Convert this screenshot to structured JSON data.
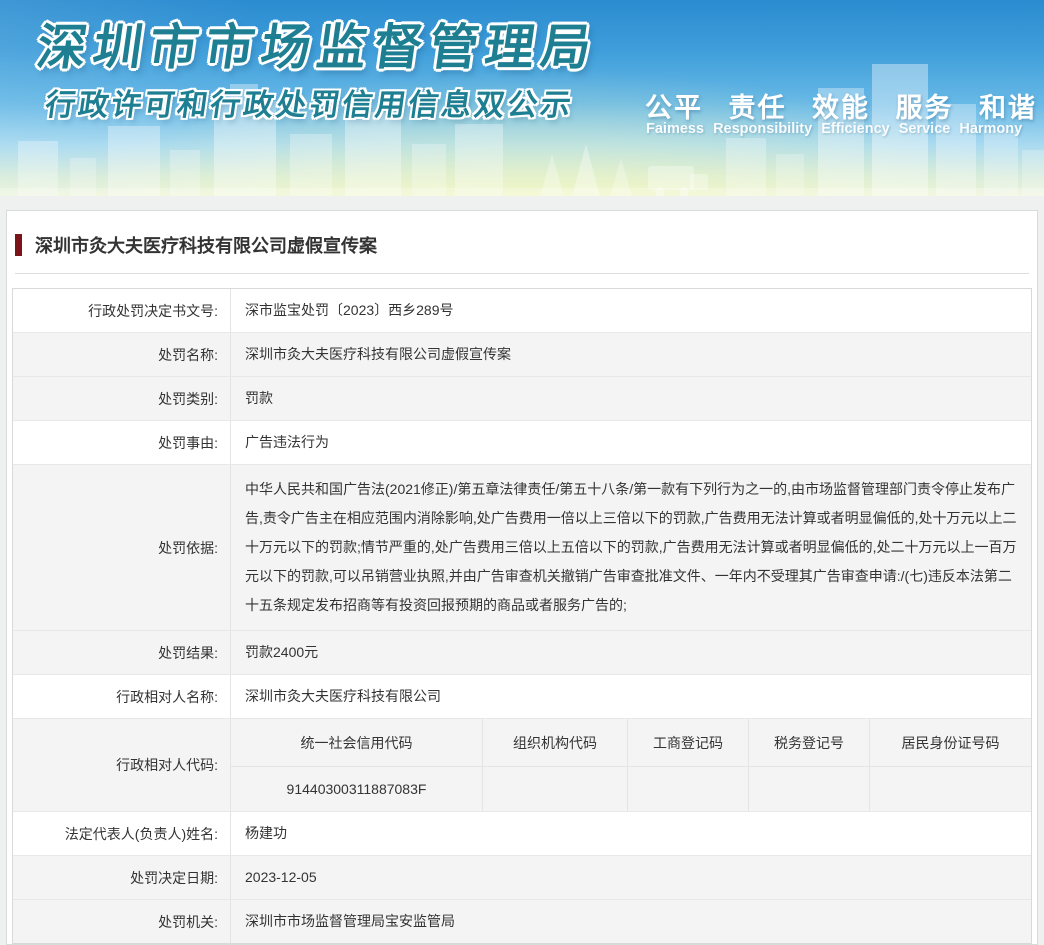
{
  "banner": {
    "agency_title": "深圳市市场监督管理局",
    "banner_subtitle": "行政许可和行政处罚信用信息双公示",
    "slogan_cn": "公平 责任 效能 服务 和谐",
    "slogan_en": "Faimess Responsibility Efficiency Service Harmony",
    "colors": {
      "banner_top_blue": "#2a8bd0",
      "banner_bottom_green": "#ebf4da",
      "title_teal": "#1e7f92"
    }
  },
  "page": {
    "case_title": "深圳市灸大夫医疗科技有限公司虚假宣传案",
    "title_marker_color": "#7a1418"
  },
  "table": {
    "rows": [
      {
        "label": "行政处罚决定书文号:",
        "value": "深市监宝处罚〔2023〕西乡289号"
      },
      {
        "label": "处罚名称:",
        "value": "深圳市灸大夫医疗科技有限公司虚假宣传案"
      },
      {
        "label": "处罚类别:",
        "value": "罚款"
      },
      {
        "label": "处罚事由:",
        "value": "广告违法行为"
      },
      {
        "label": "处罚依据:",
        "value": "中华人民共和国广告法(2021修正)/第五章法律责任/第五十八条/第一款有下列行为之一的,由市场监督管理部门责令停止发布广告,责令广告主在相应范围内消除影响,处广告费用一倍以上三倍以下的罚款,广告费用无法计算或者明显偏低的,处十万元以上二十万元以下的罚款;情节严重的,处广告费用三倍以上五倍以下的罚款,广告费用无法计算或者明显偏低的,处二十万元以上一百万元以下的罚款,可以吊销营业执照,并由广告审查机关撤销广告审查批准文件、一年内不受理其广告审查申请:/(七)违反本法第二十五条规定发布招商等有投资回报预期的商品或者服务广告的;"
      },
      {
        "label": "处罚结果:",
        "value": "罚款2400元"
      },
      {
        "label": "行政相对人名称:",
        "value": "深圳市灸大夫医疗科技有限公司"
      },
      {
        "label": "法定代表人(负责人)姓名:",
        "value": "杨建功"
      },
      {
        "label": "处罚决定日期:",
        "value": "2023-12-05"
      },
      {
        "label": "处罚机关:",
        "value": "深圳市市场监督管理局宝安监管局"
      }
    ],
    "code_row": {
      "label": "行政相对人代码:",
      "columns": [
        "统一社会信用代码",
        "组织机构代码",
        "工商登记码",
        "税务登记号",
        "居民身份证号码"
      ],
      "values": [
        "91440300311887083F",
        "",
        "",
        "",
        ""
      ]
    }
  }
}
